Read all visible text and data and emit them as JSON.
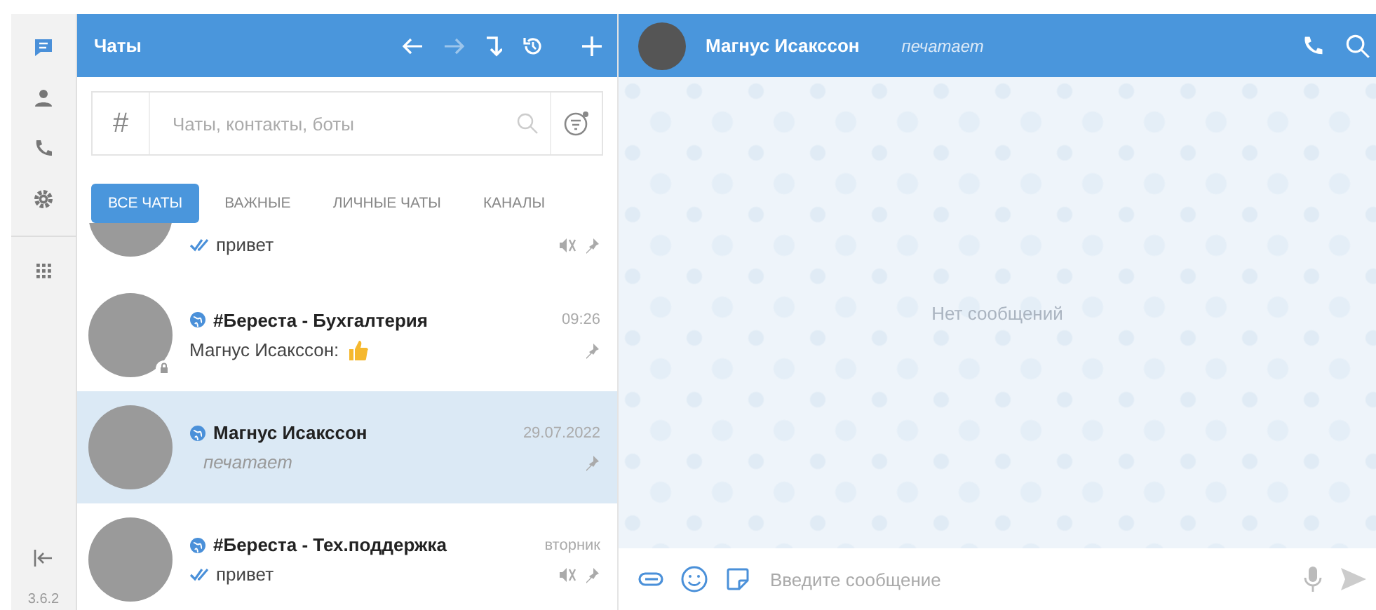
{
  "rail": {
    "items": [
      {
        "kind": "chats",
        "selected": true
      },
      {
        "kind": "contacts",
        "selected": false
      },
      {
        "kind": "calls",
        "selected": false
      },
      {
        "kind": "settings",
        "selected": false
      },
      {
        "kind": "apps",
        "selected": false
      }
    ],
    "version": "3.6.2"
  },
  "list_header": {
    "title": "Чаты",
    "back_enabled": true,
    "forward_enabled": false
  },
  "search": {
    "prefix": "#",
    "placeholder": "Чаты, контакты, боты"
  },
  "tabs": [
    {
      "label": "ВСЕ ЧАТЫ",
      "selected": true
    },
    {
      "label": "ВАЖНЫЕ",
      "selected": false
    },
    {
      "label": "ЛИЧНЫЕ ЧАТЫ",
      "selected": false
    },
    {
      "label": "КАНАЛЫ",
      "selected": false
    }
  ],
  "chats": [
    {
      "partial": true,
      "preview": "привет",
      "read": true,
      "typing": false,
      "muted": true,
      "pinned": true,
      "selected": false,
      "public": false,
      "private": false,
      "thumbs_up": false
    },
    {
      "partial": false,
      "name": "#Береста - Бухгалтерия",
      "preview": "Магнус Исакссон:",
      "read": false,
      "typing": false,
      "time": "09:26",
      "muted": false,
      "pinned": true,
      "selected": false,
      "public": true,
      "private": true,
      "thumbs_up": true
    },
    {
      "partial": false,
      "name": "Магнус Исакссон",
      "preview": "печатает",
      "read": false,
      "typing": true,
      "time": "29.07.2022",
      "muted": false,
      "pinned": true,
      "selected": true,
      "public": true,
      "private": false,
      "thumbs_up": false
    },
    {
      "partial": false,
      "name": "#Береста - Тех.поддержка",
      "preview": "привет",
      "read": true,
      "typing": false,
      "time": "вторник",
      "muted": true,
      "pinned": true,
      "selected": false,
      "public": true,
      "private": false,
      "thumbs_up": false
    }
  ],
  "conversation": {
    "name": "Магнус Исакссон",
    "status": "печатает",
    "empty_text": "Нет сообщений",
    "composer_placeholder": "Введите сообщение"
  }
}
